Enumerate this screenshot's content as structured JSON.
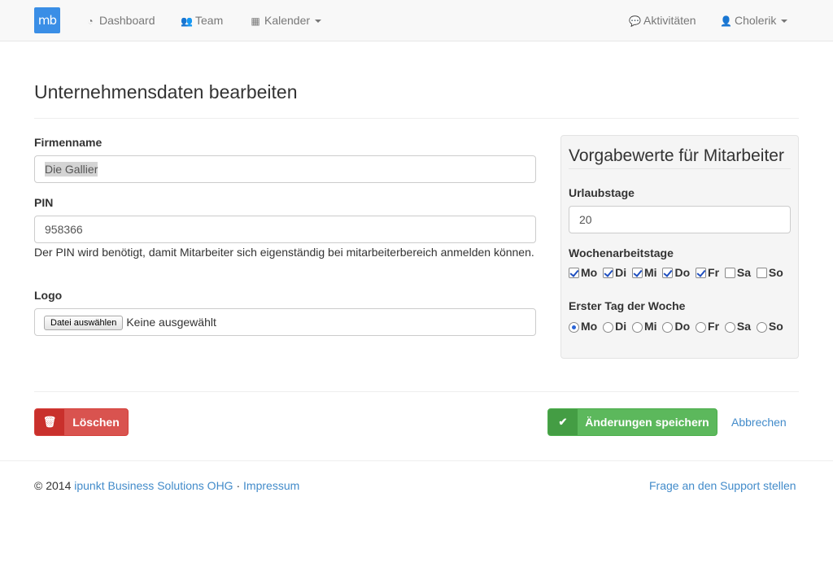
{
  "nav": {
    "brand_text": "mb",
    "items": [
      {
        "label": "Dashboard",
        "icon": "dashboard-icon",
        "glyph": "◔"
      },
      {
        "label": "Team",
        "icon": "users-icon",
        "glyph": "👥"
      },
      {
        "label": "Kalender",
        "icon": "calendar-icon",
        "glyph": "▦"
      }
    ],
    "right": {
      "activities": {
        "label": "Aktivitäten",
        "icon": "comment-icon",
        "glyph": "💬"
      },
      "user": {
        "label": "Cholerik",
        "icon": "user-icon",
        "glyph": "👤"
      }
    }
  },
  "page": {
    "title": "Unternehmensdaten bearbeiten"
  },
  "form": {
    "company": {
      "label": "Firmenname",
      "value": "Die Gallier"
    },
    "pin": {
      "label": "PIN",
      "value": "958366",
      "help": "Der PIN wird benötigt, damit Mitarbeiter sich eigenständig bei mitarbeiterbereich anmelden können."
    },
    "logo": {
      "label": "Logo",
      "button": "Datei auswählen",
      "status": "Keine ausgewählt"
    }
  },
  "defaults": {
    "title": "Vorgabewerte für Mitarbeiter",
    "vacation": {
      "label": "Urlaubstage",
      "value": "20"
    },
    "workdays": {
      "label": "Wochenarbeitstage",
      "days": [
        {
          "label": "Mo",
          "checked": true
        },
        {
          "label": "Di",
          "checked": true
        },
        {
          "label": "Mi",
          "checked": true
        },
        {
          "label": "Do",
          "checked": true
        },
        {
          "label": "Fr",
          "checked": true
        },
        {
          "label": "Sa",
          "checked": false
        },
        {
          "label": "So",
          "checked": false
        }
      ]
    },
    "first_day": {
      "label": "Erster Tag der Woche",
      "days": [
        "Mo",
        "Di",
        "Mi",
        "Do",
        "Fr",
        "Sa",
        "So"
      ],
      "selected": "Mo"
    }
  },
  "actions": {
    "delete": {
      "label": "Löschen",
      "icon": "trash-icon",
      "color": "#d9534f"
    },
    "save": {
      "label": "Änderungen speichern",
      "icon": "check-icon",
      "color": "#5cb85c"
    },
    "cancel": {
      "label": "Abbrechen"
    }
  },
  "footer": {
    "copyright": "© 2014",
    "company_link": "ipunkt Business Solutions OHG",
    "separator": "·",
    "imprint_link": "Impressum",
    "support_link": "Frage an den Support stellen"
  },
  "colors": {
    "brand": "#3a8ee6",
    "link": "#428bca"
  }
}
